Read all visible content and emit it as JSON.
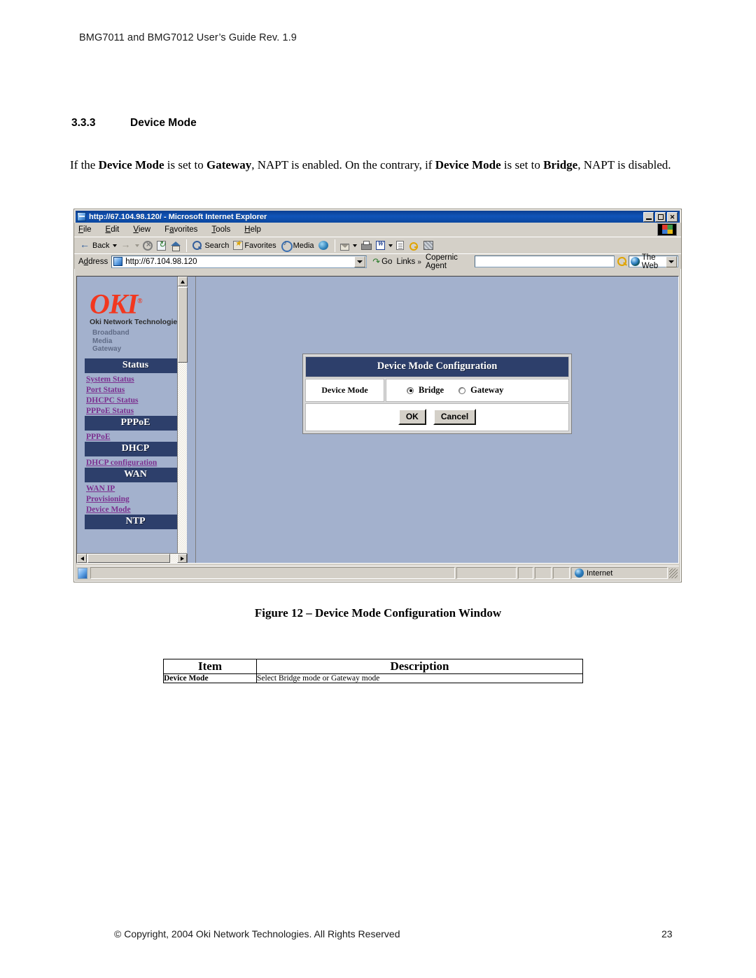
{
  "document": {
    "header": "BMG7011 and BMG7012 User’s Guide Rev. 1.9",
    "footer_copyright": "© Copyright, 2004 Oki Network Technologies. All Rights Reserved",
    "page_number": "23",
    "section_number": "3.3.3",
    "section_title": "Device Mode",
    "body_paragraph": {
      "part1": "If the ",
      "bold1": "Device Mode",
      "part2": " is set to ",
      "bold2": "Gateway",
      "part3": ", NAPT is enabled. On the contrary, if ",
      "bold3": "Device Mode",
      "part4": " is set to ",
      "bold4": "Bridge",
      "part5": ", NAPT is disabled."
    },
    "figure_caption": "Figure 12 – Device Mode Configuration Window"
  },
  "item_table": {
    "headers": [
      "Item",
      "Description"
    ],
    "rows": [
      {
        "item": "Device Mode",
        "description": "Select Bridge mode or Gateway mode"
      }
    ]
  },
  "browser": {
    "title": "http://67.104.98.120/ - Microsoft Internet Explorer",
    "title_icon": "ie-document-icon",
    "window_buttons": {
      "minimize": "_",
      "maximize": "□",
      "close": "✕"
    },
    "menu": [
      {
        "label": "File",
        "accel": "F"
      },
      {
        "label": "Edit",
        "accel": "E"
      },
      {
        "label": "View",
        "accel": "V"
      },
      {
        "label": "Favorites",
        "accel": "a"
      },
      {
        "label": "Tools",
        "accel": "T"
      },
      {
        "label": "Help",
        "accel": "H"
      }
    ],
    "brand_logo_icon": "windows-flag-icon",
    "toolbar": [
      {
        "label": "Back",
        "icon": "back-arrow-icon",
        "enabled": true,
        "has_dropdown": true
      },
      {
        "label": "",
        "icon": "forward-arrow-icon",
        "enabled": false,
        "has_dropdown": true
      },
      {
        "label": "",
        "icon": "stop-icon",
        "enabled": true
      },
      {
        "label": "",
        "icon": "refresh-icon",
        "enabled": true
      },
      {
        "label": "",
        "icon": "home-icon",
        "enabled": true
      },
      {
        "label": "Search",
        "icon": "search-icon",
        "enabled": true
      },
      {
        "label": "Favorites",
        "icon": "favorites-star-icon",
        "enabled": true
      },
      {
        "label": "Media",
        "icon": "media-icon",
        "enabled": true
      },
      {
        "label": "",
        "icon": "history-icon",
        "enabled": true
      },
      {
        "label": "",
        "icon": "mail-icon",
        "enabled": true,
        "has_dropdown": true
      },
      {
        "label": "",
        "icon": "print-icon",
        "enabled": true
      },
      {
        "label": "",
        "icon": "word-icon",
        "enabled": true,
        "has_dropdown": true
      },
      {
        "label": "",
        "icon": "edit-page-icon",
        "enabled": true
      },
      {
        "label": "",
        "icon": "key-icon",
        "enabled": true
      },
      {
        "label": "",
        "icon": "messenger-icon",
        "enabled": true
      }
    ],
    "address_bar": {
      "label": "Address",
      "icon": "ie-page-icon",
      "value": "http://67.104.98.120",
      "dropdown_icon": "chevron-down-icon",
      "go_label": "Go",
      "go_icon": "go-arrow-icon",
      "links_label": "Links",
      "links_chevron": "»"
    },
    "copernic": {
      "label": "Copernic Agent",
      "search_value": "",
      "search_icon": "magnifier-icon",
      "scope_label": "The Web",
      "scope_icon": "globe-icon",
      "scope_dropdown_icon": "chevron-down-icon"
    },
    "status_bar": {
      "icon": "ie-status-icon",
      "text": "",
      "zone_label": "Internet",
      "zone_icon": "globe-icon",
      "resize_grip_icon": "resize-grip-icon"
    }
  },
  "webpage": {
    "logo": {
      "brand": "OKI",
      "registered": "®",
      "subtitle": "Oki Network Technologies",
      "tagline_lines": [
        "Broadband",
        "Media",
        "Gateway"
      ]
    },
    "nav": [
      {
        "type": "header",
        "label": "Status"
      },
      {
        "type": "link",
        "label": "System Status"
      },
      {
        "type": "link",
        "label": "Port Status"
      },
      {
        "type": "link",
        "label": "DHCPC Status"
      },
      {
        "type": "link",
        "label": "PPPoE Status"
      },
      {
        "type": "header",
        "label": "PPPoE"
      },
      {
        "type": "link",
        "label": "PPPoE"
      },
      {
        "type": "header",
        "label": "DHCP"
      },
      {
        "type": "link",
        "label": "DHCP configuration"
      },
      {
        "type": "header",
        "label": "WAN"
      },
      {
        "type": "link",
        "label": "WAN IP"
      },
      {
        "type": "link",
        "label": "Provisioning"
      },
      {
        "type": "link",
        "label": "Device Mode"
      },
      {
        "type": "header",
        "label": "NTP"
      }
    ],
    "config_panel": {
      "title": "Device Mode Configuration",
      "row_label": "Device Mode",
      "options": [
        {
          "label": "Bridge",
          "selected": true
        },
        {
          "label": "Gateway",
          "selected": false
        }
      ],
      "ok_label": "OK",
      "cancel_label": "Cancel"
    }
  },
  "colors": {
    "page_background": "#a3b1cd",
    "nav_header": "#2d3f6b",
    "nav_link": "#7b2f8f",
    "logo_red": "#f2371f",
    "titlebar_blue": "#0b3f91",
    "chrome_gray": "#d4d0c8"
  }
}
